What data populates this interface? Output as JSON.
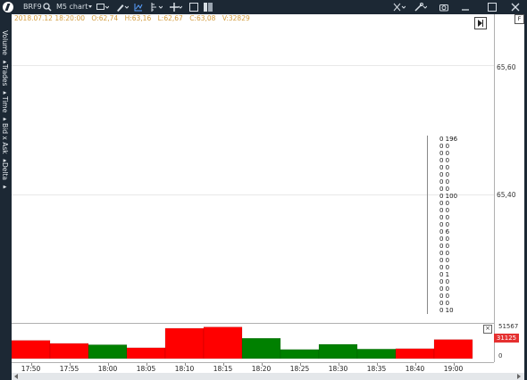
{
  "toolbar": {
    "symbol": "BRF9",
    "timeframe": "M5 chart",
    "icons": [
      "search-icon",
      "chart-type-icon",
      "pencil-icon",
      "indicator-icon",
      "bar-style-icon",
      "crosshair-icon",
      "window-icon",
      "layout-icon",
      "tools-icon",
      "link-icon",
      "camera-icon",
      "minimize-icon",
      "maximize-icon",
      "close-icon"
    ]
  },
  "side_panel": [
    "Volume",
    "Trades",
    "Time",
    "Bid x Ask",
    "Delta"
  ],
  "info": {
    "datetime": "2018.07.12 18:20:00",
    "open": "O:62,74",
    "high": "H:63,16",
    "low": "L:62,67",
    "close": "C:63,08",
    "volume": "V:32829"
  },
  "y_labels": [
    "65,60",
    "65,40"
  ],
  "volume_axis": {
    "top": "51567",
    "current": "31125",
    "bottom": "0"
  },
  "cluster_rows": [
    "0 196",
    "0 0",
    "0 0",
    "0 0",
    "0 0",
    "0 0",
    "0 0",
    "0 0",
    "0 100",
    "0 0",
    "0 0",
    "0 0",
    "0 0",
    "0 6",
    "0 0",
    "0 0",
    "0 0",
    "0 0",
    "0 0",
    "0 1",
    "0 0",
    "0 0",
    "0 0",
    "0 0",
    "0 10"
  ],
  "chart_data": {
    "type": "bar",
    "title": "",
    "categories": [
      "17:50",
      "17:55",
      "18:00",
      "18:05",
      "18:10",
      "18:15",
      "18:20",
      "18:25",
      "18:30",
      "18:35",
      "18:40",
      "19:00"
    ],
    "series": [
      {
        "values": [
          21000,
          17500,
          16000,
          12500,
          35000,
          36500,
          23500,
          10500,
          16500,
          11000,
          11500,
          22000
        ]
      }
    ],
    "bar_colors": [
      "#ff0000",
      "#ff0000",
      "#008000",
      "#ff0000",
      "#ff0000",
      "#ff0000",
      "#008000",
      "#008000",
      "#008000",
      "#008000",
      "#ff0000",
      "#ff0000"
    ],
    "ylim": [
      0,
      51567
    ],
    "colors": {
      "up": "#008000",
      "down": "#ff0000"
    }
  }
}
